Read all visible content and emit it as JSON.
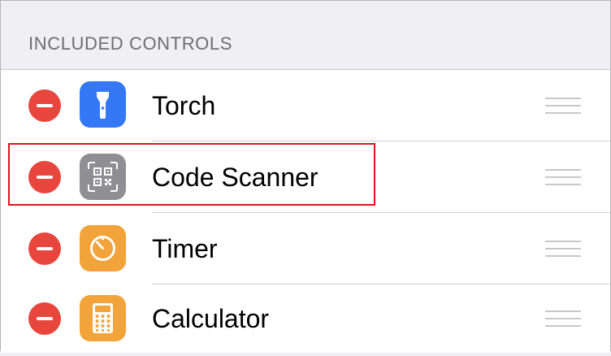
{
  "section": {
    "title": "INCLUDED CONTROLS"
  },
  "controls": [
    {
      "label": "Torch",
      "icon": "torch-icon",
      "color": "#3478f6"
    },
    {
      "label": "Code Scanner",
      "icon": "qr-code-icon",
      "color": "#8e8e93"
    },
    {
      "label": "Timer",
      "icon": "timer-icon",
      "color": "#f2a33a"
    },
    {
      "label": "Calculator",
      "icon": "calculator-icon",
      "color": "#f2a33a"
    }
  ],
  "highlight": {
    "target": "Code Scanner",
    "color": "#e3121b"
  },
  "colors": {
    "remove": "#e8463c",
    "background": "#efeff4",
    "separator": "#d1d1d6"
  }
}
